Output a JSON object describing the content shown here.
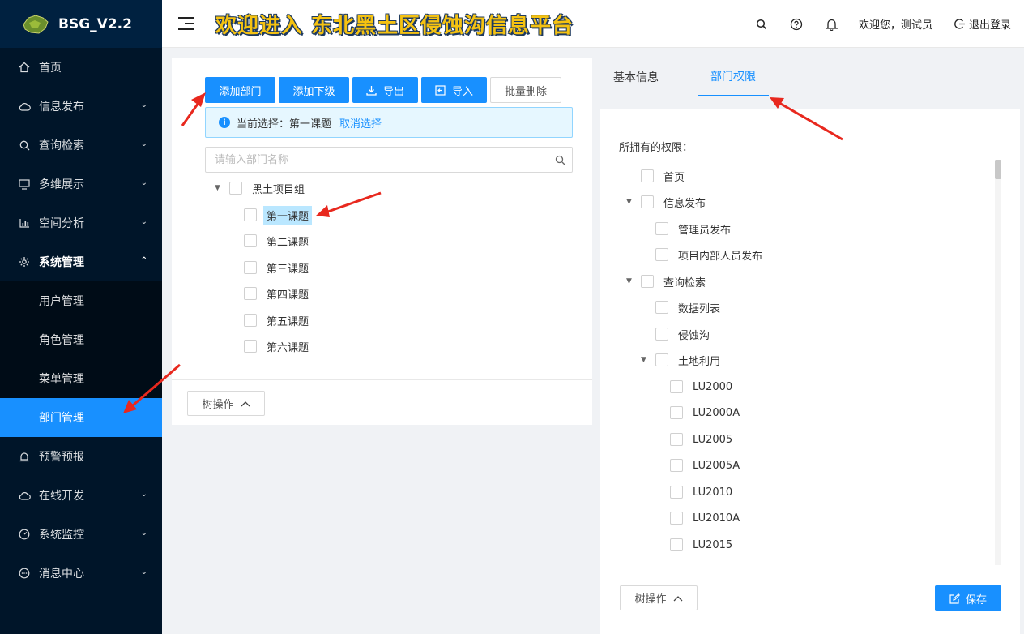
{
  "app": {
    "name": "BSG_V2.2"
  },
  "header": {
    "title": "欢迎进入 东北黑土区侵蚀沟信息平台",
    "welcome": "欢迎您，测试员",
    "logout": "退出登录"
  },
  "sidebar": {
    "items": [
      {
        "label": "首页",
        "icon": "home-icon"
      },
      {
        "label": "信息发布",
        "icon": "cloud-icon"
      },
      {
        "label": "查询检索",
        "icon": "search-icon"
      },
      {
        "label": "多维展示",
        "icon": "monitor-icon"
      },
      {
        "label": "空间分析",
        "icon": "bar-chart-icon"
      },
      {
        "label": "系统管理",
        "icon": "gear-icon"
      },
      {
        "label": "预警预报",
        "icon": "alarm-icon"
      },
      {
        "label": "在线开发",
        "icon": "cloud-icon"
      },
      {
        "label": "系统监控",
        "icon": "dashboard-icon"
      },
      {
        "label": "消息中心",
        "icon": "message-icon"
      }
    ],
    "sub_items": [
      {
        "label": "用户管理"
      },
      {
        "label": "角色管理"
      },
      {
        "label": "菜单管理"
      },
      {
        "label": "部门管理"
      }
    ]
  },
  "left": {
    "buttons": {
      "add_dept": "添加部门",
      "add_child": "添加下级",
      "export": "导出",
      "import": "导入",
      "batch_delete": "批量删除"
    },
    "alert": {
      "prefix": "当前选择：",
      "value": "第一课题",
      "cancel": "取消选择"
    },
    "search_placeholder": "请输入部门名称",
    "tree": {
      "root": "黑土项目组",
      "children": [
        "第一课题",
        "第二课题",
        "第三课题",
        "第四课题",
        "第五课题",
        "第六课题"
      ]
    },
    "tree_op": "树操作"
  },
  "right": {
    "tabs": [
      "基本信息",
      "部门权限"
    ],
    "perm_title": "所拥有的权限：",
    "perms": [
      {
        "label": "首页"
      },
      {
        "label": "信息发布"
      },
      {
        "label": "管理员发布"
      },
      {
        "label": "项目内部人员发布"
      },
      {
        "label": "查询检索"
      },
      {
        "label": "数据列表"
      },
      {
        "label": "侵蚀沟"
      },
      {
        "label": "土地利用"
      },
      {
        "label": "LU2000"
      },
      {
        "label": "LU2000A"
      },
      {
        "label": "LU2005"
      },
      {
        "label": "LU2005A"
      },
      {
        "label": "LU2010"
      },
      {
        "label": "LU2010A"
      },
      {
        "label": "LU2015"
      }
    ],
    "tree_op": "树操作",
    "save": "保存"
  }
}
